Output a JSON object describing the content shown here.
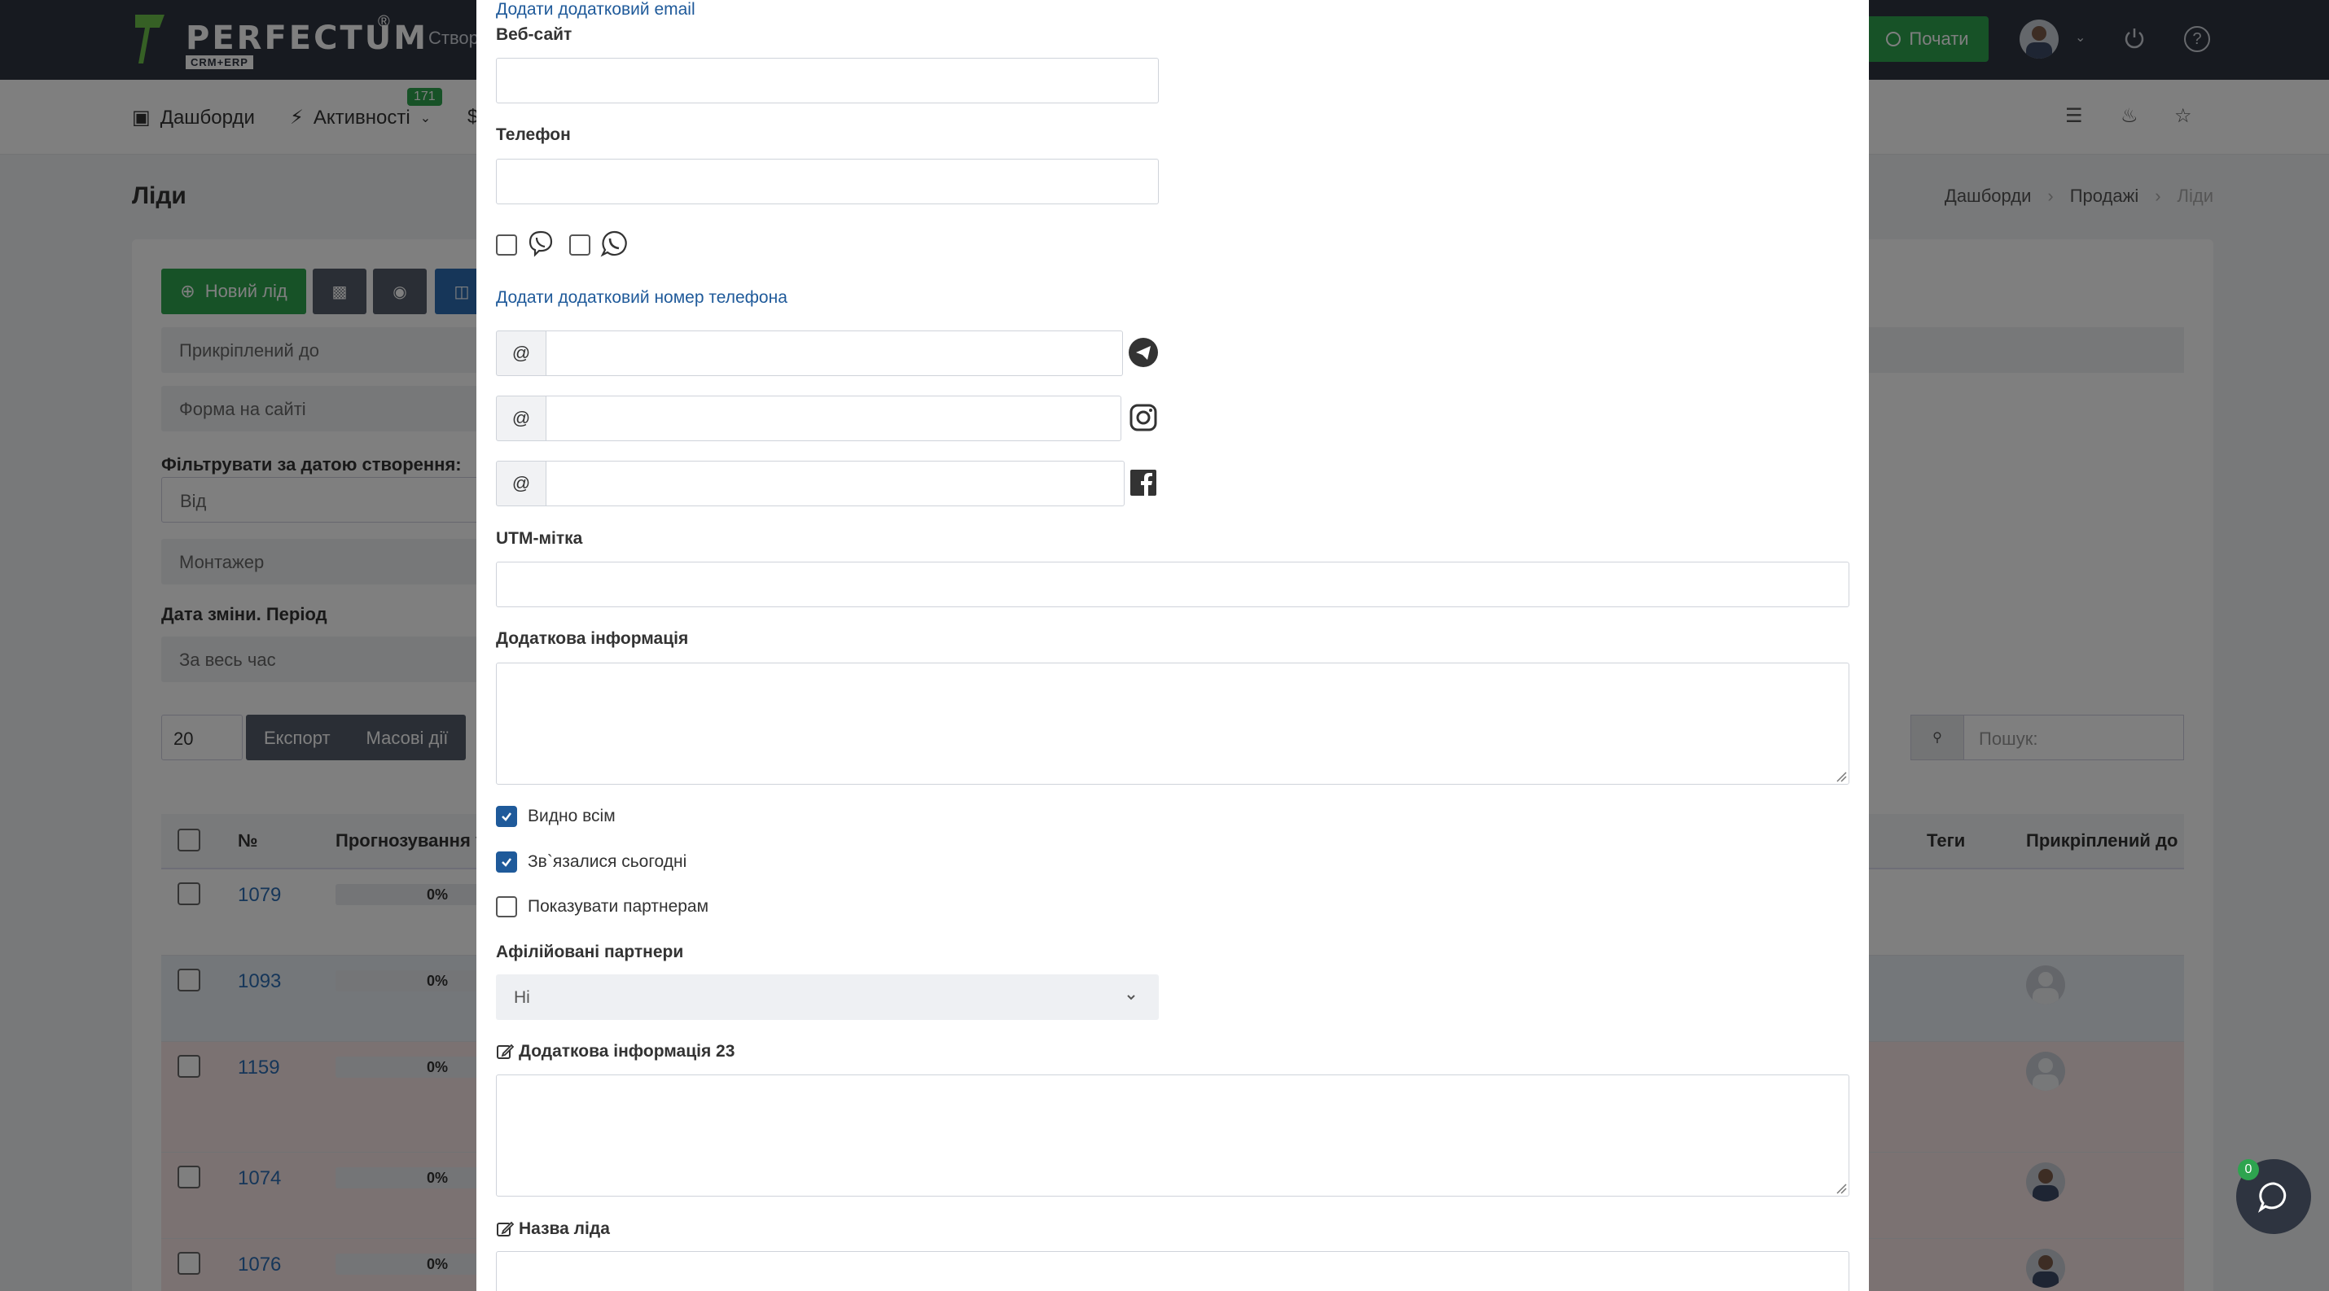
{
  "header": {
    "brand": "PERFECTUM",
    "brand_reg": "®",
    "brand_sub": "CRM+ERP",
    "create_label": "Створ",
    "start_label": "Почати",
    "help_label": "?"
  },
  "nav": {
    "dashboards": "Дашборди",
    "activities": "Активності",
    "activities_badge": "171",
    "partial": "$"
  },
  "page": {
    "title": "Ліди",
    "breadcrumb": [
      "Дашборди",
      "Продажі",
      "Ліди"
    ]
  },
  "toolbar": {
    "new_lead": "Новий лід",
    "attached_to": "Прикріплений до",
    "site_form": "Форма на сайті",
    "filter_date_label": "Фільтрувати за датою створення:",
    "from_placeholder": "Від",
    "installer": "Монтажер",
    "change_date_label": "Дата зміни. Період",
    "all_time": "За весь час",
    "per_page": "20",
    "export": "Експорт",
    "bulk": "Масові дії",
    "search_placeholder": "Пошук:"
  },
  "table": {
    "headers": {
      "num": "№",
      "forecast": "Прогнозування успіх",
      "tags": "Теги",
      "attached": "Прикріплений до"
    },
    "rows": [
      {
        "num": "1079",
        "forecast": "0%",
        "avatar": "none"
      },
      {
        "num": "1093",
        "forecast": "0%",
        "avatar": "placeholder"
      },
      {
        "num": "1159",
        "forecast": "0%",
        "avatar": "placeholder"
      },
      {
        "num": "1074",
        "forecast": "0%",
        "avatar": "photo"
      },
      {
        "num": "1076",
        "forecast": "0%",
        "avatar": "photo"
      }
    ]
  },
  "modal": {
    "add_email_link": "Додати додатковий email",
    "website_label": "Веб-сайт",
    "website_value": "",
    "phone_label": "Телефон",
    "phone_value": "",
    "add_phone_link": "Додати додатковий номер телефона",
    "at_symbol": "@",
    "telegram_value": "",
    "instagram_value": "",
    "facebook_value": "",
    "utm_label": "UTM-мітка",
    "utm_value": "",
    "extra_info_label": "Додаткова інформація",
    "extra_info_value": "",
    "visible_all_label": "Видно всім",
    "visible_all_checked": true,
    "contacted_today_label": "Зв`язалися сьогодні",
    "contacted_today_checked": true,
    "show_partners_label": "Показувати партнерам",
    "show_partners_checked": false,
    "affiliated_label": "Афілійовані партнери",
    "affiliated_value": "Ні",
    "extra_info_23_label": "Додаткова інформація 23",
    "extra_info_23_value": "",
    "lead_name_label": "Назва ліда",
    "lead_name_value": ""
  },
  "chat": {
    "count": "0"
  },
  "colors": {
    "topbar": "#2e3440",
    "accent_green": "#2ea44f",
    "link_blue": "#1f5a9a",
    "overlay": "rgba(0,0,0,0.5)"
  }
}
